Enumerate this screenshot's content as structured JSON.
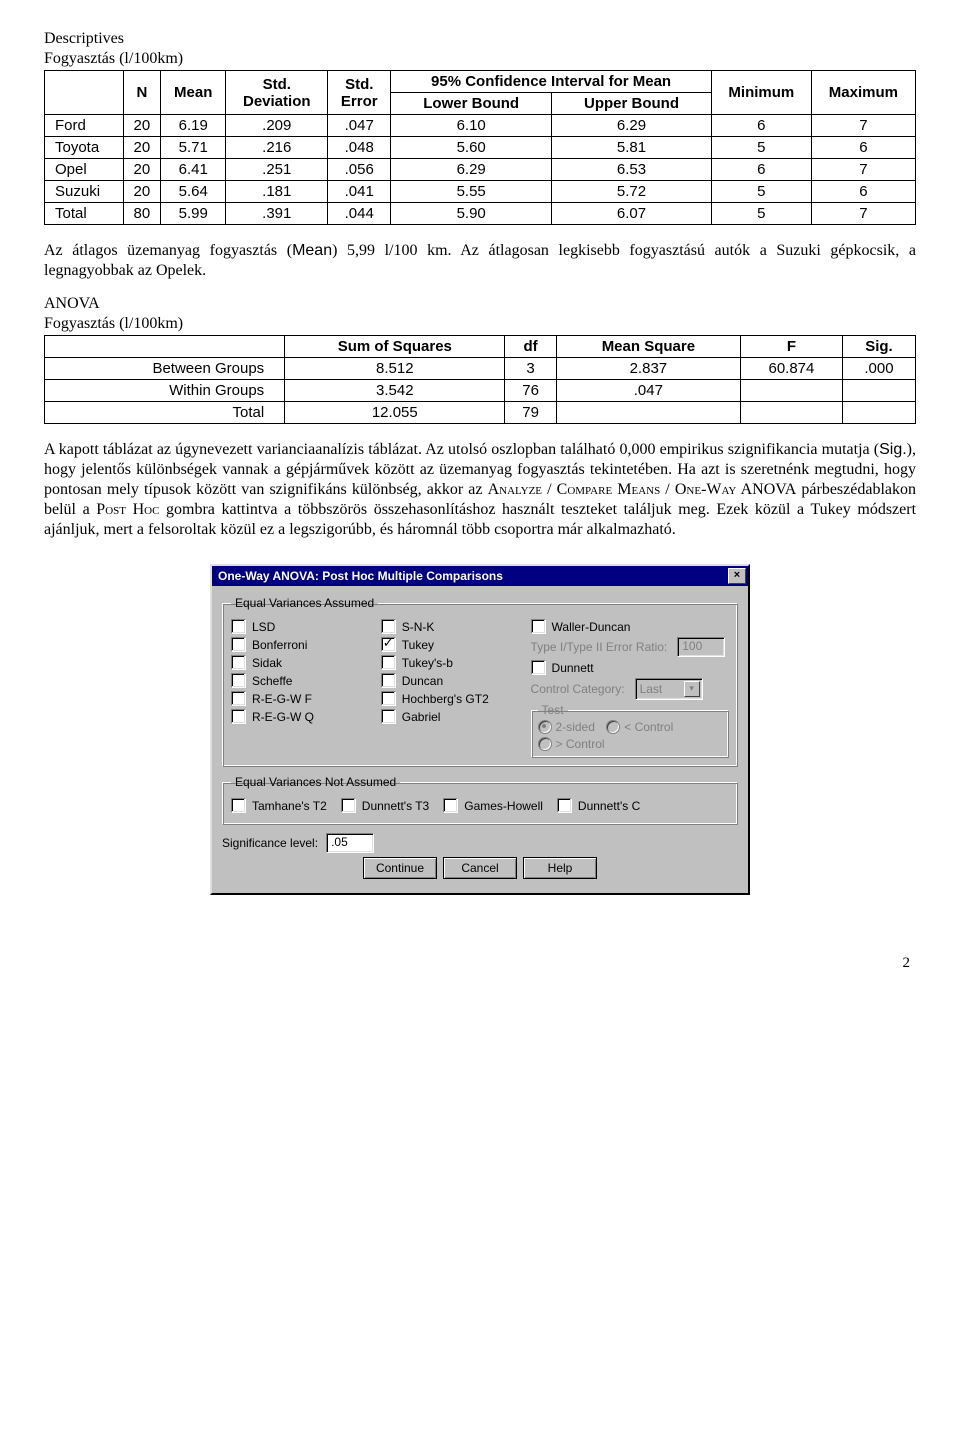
{
  "table1_title": "Descriptives",
  "table1_subtitle": "Fogyasztás (l/100km)",
  "desc_headers": {
    "N": "N",
    "Mean": "Mean",
    "StdDev": "Std.\nDeviation",
    "StdErr": "Std.\nError",
    "CI": "95% Confidence Interval for Mean",
    "Min": "Minimum",
    "Max": "Maximum",
    "Lower": "Lower Bound",
    "Upper": "Upper Bound"
  },
  "desc_rows": [
    {
      "name": "Ford",
      "n": "20",
      "mean": "6.19",
      "sd": ".209",
      "se": ".047",
      "lb": "6.10",
      "ub": "6.29",
      "min": "6",
      "max": "7"
    },
    {
      "name": "Toyota",
      "n": "20",
      "mean": "5.71",
      "sd": ".216",
      "se": ".048",
      "lb": "5.60",
      "ub": "5.81",
      "min": "5",
      "max": "6"
    },
    {
      "name": "Opel",
      "n": "20",
      "mean": "6.41",
      "sd": ".251",
      "se": ".056",
      "lb": "6.29",
      "ub": "6.53",
      "min": "6",
      "max": "7"
    },
    {
      "name": "Suzuki",
      "n": "20",
      "mean": "5.64",
      "sd": ".181",
      "se": ".041",
      "lb": "5.55",
      "ub": "5.72",
      "min": "5",
      "max": "6"
    },
    {
      "name": "Total",
      "n": "80",
      "mean": "5.99",
      "sd": ".391",
      "se": ".044",
      "lb": "5.90",
      "ub": "6.07",
      "min": "5",
      "max": "7"
    }
  ],
  "para1a": "Az átlagos üzemanyag fogyasztás (",
  "para1b": "Mean",
  "para1c": ") 5,99 l/100 km. Az átlagosan legkisebb fogyasztású autók a Suzuki gépkocsik, a legnagyobbak az Opelek.",
  "table2_title": "ANOVA",
  "table2_subtitle": "Fogyasztás (l/100km)",
  "anova_headers": {
    "ss": "Sum of Squares",
    "df": "df",
    "ms": "Mean Square",
    "F": "F",
    "sig": "Sig."
  },
  "anova_rows": [
    {
      "name": "Between Groups",
      "ss": "8.512",
      "df": "3",
      "ms": "2.837",
      "F": "60.874",
      "sig": ".000"
    },
    {
      "name": "Within Groups",
      "ss": "3.542",
      "df": "76",
      "ms": ".047",
      "F": "",
      "sig": ""
    },
    {
      "name": "Total",
      "ss": "12.055",
      "df": "79",
      "ms": "",
      "F": "",
      "sig": ""
    }
  ],
  "para2a": "A kapott táblázat az úgynevezett varianciaanalízis táblázat. Az utolsó oszlopban található 0,000 empirikus szignifikancia mutatja (",
  "para2b": "Sig.",
  "para2c": "), hogy jelentős különbségek vannak a gépjárművek között az üzemanyag fogyasztás tekintetében. Ha azt is szeretnénk megtudni, hogy pontosan mely típusok között van szignifikáns különbség, akkor az ",
  "para2d": "Analyze / Compare Means / One-Way ANOVA",
  "para2e": " párbeszédablakon belül a ",
  "para2f": "Post Hoc",
  "para2g": " gombra kattintva a többszörös összehasonlításhoz használt teszteket találjuk meg. Ezek közül a Tukey módszert ajánljuk, mert a felsoroltak közül ez a legszigorúbb, és háromnál több csoportra már alkalmazható.",
  "dialog": {
    "title": "One-Way ANOVA: Post Hoc Multiple Comparisons",
    "groups": {
      "eq": "Equal Variances Assumed",
      "neq": "Equal Variances Not Assumed"
    },
    "col1": [
      "LSD",
      "Bonferroni",
      "Sidak",
      "Scheffe",
      "R-E-G-W F",
      "R-E-G-W Q"
    ],
    "col2": [
      "S-N-K",
      "Tukey",
      "Tukey's-b",
      "Duncan",
      "Hochberg's GT2",
      "Gabriel"
    ],
    "col3check": "Waller-Duncan",
    "ratioLabel": "Type I/Type II Error Ratio:",
    "ratioVal": "100",
    "dunnett": "Dunnett",
    "ctrlCat": "Control Category:",
    "ctrlVal": "Last",
    "testLegend": "Test",
    "radios": [
      "2-sided",
      "< Control",
      "> Control"
    ],
    "neqChecks": [
      "Tamhane's T2",
      "Dunnett's T3",
      "Games-Howell",
      "Dunnett's C"
    ],
    "sigLabel": "Significance level:",
    "sigVal": ".05",
    "buttons": [
      "Continue",
      "Cancel",
      "Help"
    ]
  },
  "pageNum": "2"
}
